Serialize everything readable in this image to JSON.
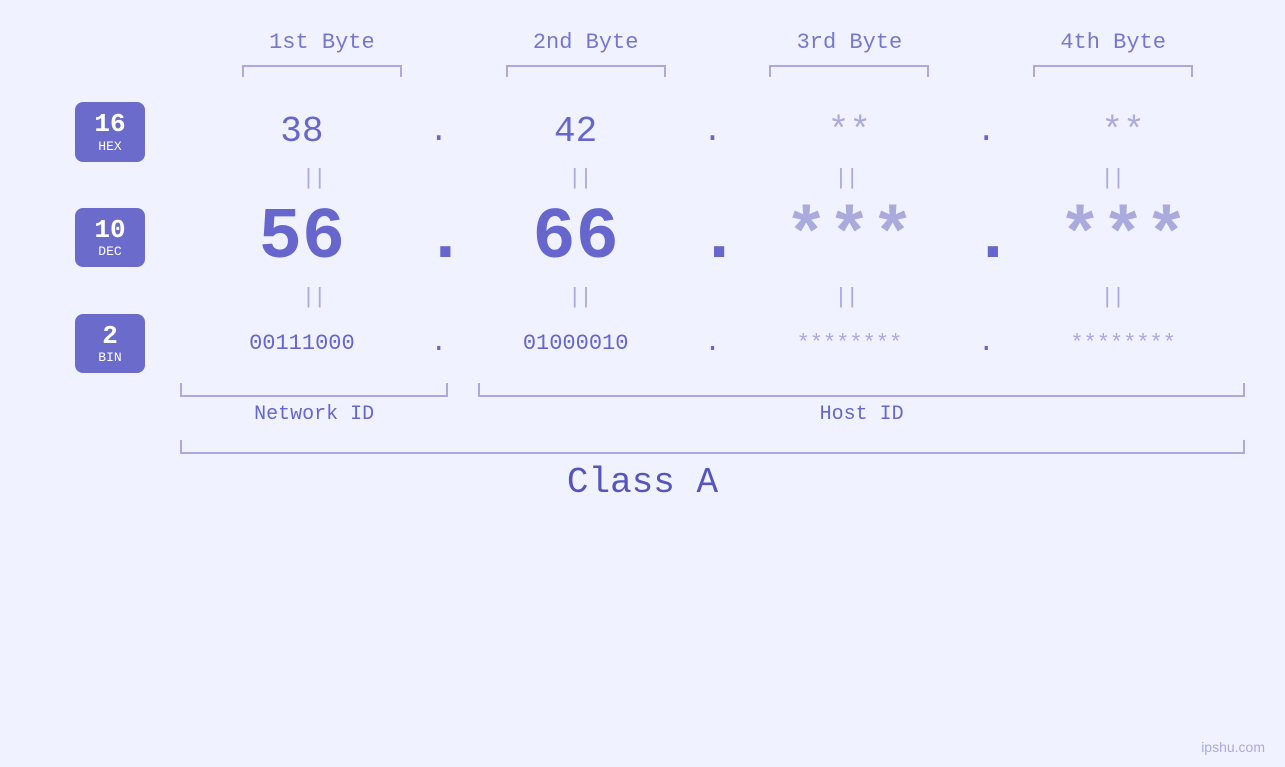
{
  "headers": {
    "byte1": "1st Byte",
    "byte2": "2nd Byte",
    "byte3": "3rd Byte",
    "byte4": "4th Byte"
  },
  "rows": {
    "hex": {
      "base_num": "16",
      "base_label": "HEX",
      "byte1": "38",
      "byte2": "42",
      "byte3": "**",
      "byte4": "**"
    },
    "dec": {
      "base_num": "10",
      "base_label": "DEC",
      "byte1": "56",
      "byte2": "66",
      "byte3": "***",
      "byte4": "***"
    },
    "bin": {
      "base_num": "2",
      "base_label": "BIN",
      "byte1": "00111000",
      "byte2": "01000010",
      "byte3": "********",
      "byte4": "********"
    }
  },
  "labels": {
    "network_id": "Network ID",
    "host_id": "Host ID",
    "class": "Class A"
  },
  "watermark": "ipshu.com"
}
